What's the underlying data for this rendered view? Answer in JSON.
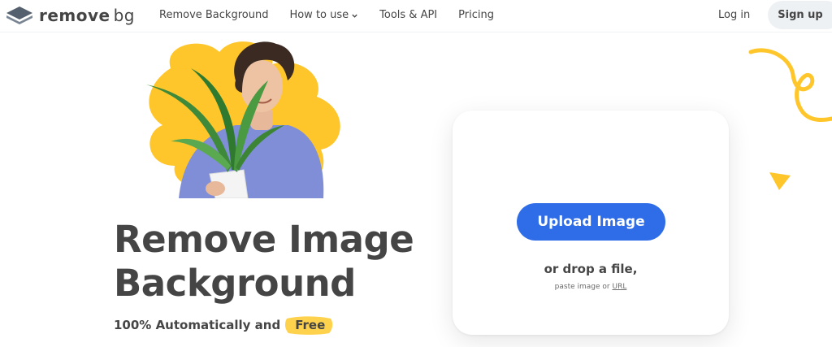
{
  "header": {
    "logo_text_1": "remove",
    "logo_text_2": "bg",
    "nav": [
      {
        "label": "Remove Background"
      },
      {
        "label": "How to use",
        "has_dropdown": true
      },
      {
        "label": "Tools & API"
      },
      {
        "label": "Pricing"
      }
    ],
    "login_label": "Log in",
    "signup_label": "Sign up"
  },
  "hero": {
    "headline_line1": "Remove Image",
    "headline_line2": "Background",
    "subline_prefix": "100% Automatically and",
    "subline_highlight": "Free"
  },
  "upload": {
    "button_label": "Upload Image",
    "drop_text": "or drop a file,",
    "paste_text": "paste image or",
    "url_link": "URL"
  },
  "colors": {
    "accent_blue": "#2f6de8",
    "highlight_yellow": "#ffd24d",
    "text_dark": "#454545",
    "signup_bg": "#eef1f4"
  }
}
